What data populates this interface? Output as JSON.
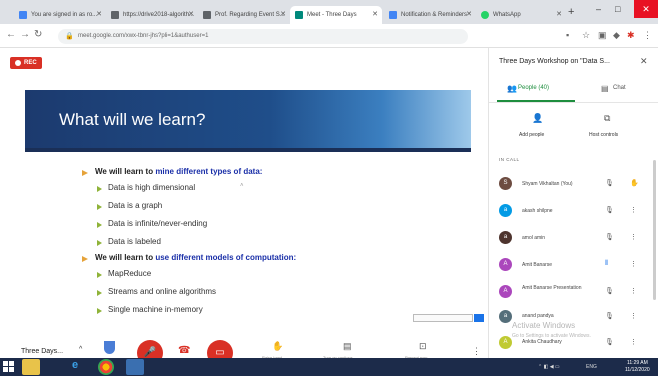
{
  "browser": {
    "tabs": [
      {
        "title": "You are signed in as ro...",
        "favicon_color": "#4285f4"
      },
      {
        "title": "https://drive2018-algorith...",
        "favicon_color": "#5f6368"
      },
      {
        "title": "Prof. Regarding Event S...",
        "favicon_color": "#5f6368"
      },
      {
        "title": "Meet - Three Days",
        "favicon_color": "#00897b"
      },
      {
        "title": "Notification & Reminders",
        "favicon_color": "#4285f4"
      },
      {
        "title": "WhatsApp",
        "favicon_color": "#25d366"
      }
    ],
    "new_tab_label": "+",
    "url": "meet.google.com/xwx-tbnr-jhs?pli=1&authuser=1",
    "window_controls": [
      "–",
      "□",
      "✕"
    ]
  },
  "meet": {
    "rec_label": "REC",
    "slide": {
      "title": "What will we learn?",
      "bullets": [
        {
          "lead": "We will learn to ",
          "highlight": "mine different types of data:",
          "subs": [
            "Data is high dimensional",
            "Data is a graph",
            "Data is infinite/never-ending",
            "Data is labeled"
          ]
        },
        {
          "lead": "We will learn to ",
          "highlight": "use different models of computation:",
          "subs": [
            "MapReduce",
            "Streams and online algorithms",
            "Single machine in-memory"
          ]
        }
      ]
    },
    "bottom_bar": {
      "meeting_name": "Three Days...",
      "chevron": "^",
      "controls": [
        {
          "icon": "raise-hand-icon",
          "glyph": "✋",
          "label": "Raise hand"
        },
        {
          "icon": "captions-icon",
          "glyph": "▤",
          "label": "Turn on captions"
        },
        {
          "icon": "present-icon",
          "glyph": "⊡",
          "label": "Present now"
        }
      ],
      "more": "⋮"
    }
  },
  "panel": {
    "title": "Three Days Workshop on \"Data S...",
    "close_glyph": "✕",
    "tabs": [
      {
        "label": "People (40)",
        "icon": "people-icon",
        "glyph": "👥",
        "active": true
      },
      {
        "label": "Chat",
        "icon": "chat-icon",
        "glyph": "▤",
        "active": false
      }
    ],
    "actions": [
      {
        "label": "Add people",
        "icon": "add-person-icon",
        "glyph": "👤"
      },
      {
        "label": "Host controls",
        "icon": "host-controls-icon",
        "glyph": "⧉"
      }
    ],
    "section_header": "IN CALL",
    "participants": [
      {
        "initial": "S",
        "name": "Shyam Vikhaltan (You)",
        "color": "#6d4c41",
        "mic": "muted",
        "extra": "✋"
      },
      {
        "initial": "a",
        "name": "akash shilpne",
        "color": "#039be5",
        "mic": "muted",
        "extra": "⋮"
      },
      {
        "initial": "a",
        "name": "amol amin",
        "color": "#4e342e",
        "mic": "muted",
        "extra": "⋮"
      },
      {
        "initial": "A",
        "name": "Amit Banarse",
        "color": "#ab47bc",
        "mic": "active",
        "extra": "⋮"
      },
      {
        "initial": "A",
        "name": "Amit Banarse Presentation",
        "color": "#ab47bc",
        "mic": "muted",
        "extra": "⋮"
      },
      {
        "initial": "a",
        "name": "anand pandya",
        "color": "#546e7a",
        "mic": "muted",
        "extra": "⋮"
      },
      {
        "initial": "A",
        "name": "Ankita Chaudhary",
        "color": "#c0ca33",
        "mic": "muted",
        "extra": "⋮"
      }
    ]
  },
  "watermark": {
    "line1": "Activate Windows",
    "line2": "Go to Settings to activate Windows."
  },
  "taskbar": {
    "clock_time": "11:29 AM",
    "clock_date": "11/12/2020",
    "tray_lang": "ENG"
  }
}
